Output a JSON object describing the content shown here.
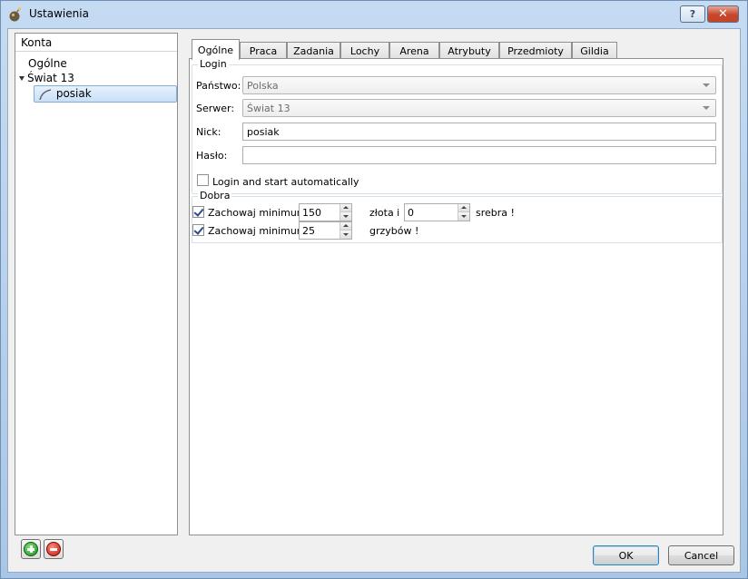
{
  "window": {
    "title": "Ustawienia",
    "help_label": "?",
    "close_label": "✕"
  },
  "tree": {
    "header": "Konta",
    "items": [
      {
        "label": "Ogólne"
      },
      {
        "label": "Świat 13"
      },
      {
        "label": "posiak"
      }
    ]
  },
  "tabs": [
    "Ogólne",
    "Praca",
    "Zadania",
    "Lochy",
    "Arena",
    "Atrybuty",
    "Przedmioty",
    "Gildia"
  ],
  "login": {
    "group_label": "Login",
    "country_label": "Państwo:",
    "country_value": "Polska",
    "server_label": "Serwer:",
    "server_value": "Świat 13",
    "nick_label": "Nick:",
    "nick_value": "posiak",
    "password_label": "Hasło:",
    "password_value": "",
    "auto_login_label": "Login and start automatically"
  },
  "dobra": {
    "group_label": "Dobra",
    "row1": {
      "label": "Zachowaj minimum",
      "gold_value": "150",
      "gold_text": "złota i",
      "silver_value": "0",
      "silver_text": "srebra !"
    },
    "row2": {
      "label": "Zachowaj minimum",
      "value": "25",
      "text": "grzybów !"
    }
  },
  "buttons": {
    "ok": "OK",
    "cancel": "Cancel"
  }
}
